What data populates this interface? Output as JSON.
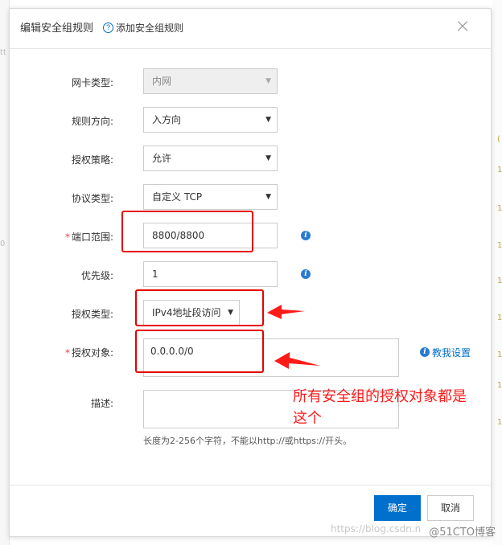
{
  "dialog": {
    "title": "编辑安全组规则",
    "help_icon_text": "?",
    "help_link": "添加安全组规则",
    "close_glyph": "×"
  },
  "form": {
    "nic_type": {
      "label": "网卡类型:",
      "value": "内网"
    },
    "direction": {
      "label": "规则方向:",
      "value": "入方向"
    },
    "policy": {
      "label": "授权策略:",
      "value": "允许"
    },
    "protocol": {
      "label": "协议类型:",
      "value": "自定义 TCP"
    },
    "port_range": {
      "label": "端口范围:",
      "required": "*",
      "value": "8800/8800"
    },
    "priority": {
      "label": "优先级:",
      "value": "1"
    },
    "auth_type": {
      "label": "授权类型:",
      "value": "IPv4地址段访问"
    },
    "auth_object": {
      "label": "授权对象:",
      "required": "*",
      "value": "0.0.0.0/0",
      "teach_link": "教我设置"
    },
    "description": {
      "label": "描述:",
      "value": "",
      "hint": "长度为2-256个字符，不能以http://或https://开头。"
    }
  },
  "footer": {
    "confirm_label": "确定",
    "cancel_label": "取消"
  },
  "annotation": {
    "line1": "所有安全组的授权对象都是",
    "line2": "这个"
  },
  "watermark": {
    "left": "https://blog.csdn.n",
    "right": "@51CTO博客"
  },
  "colors": {
    "primary": "#0070cc",
    "annotation_red": "#e60000",
    "required_red": "#e64545"
  }
}
